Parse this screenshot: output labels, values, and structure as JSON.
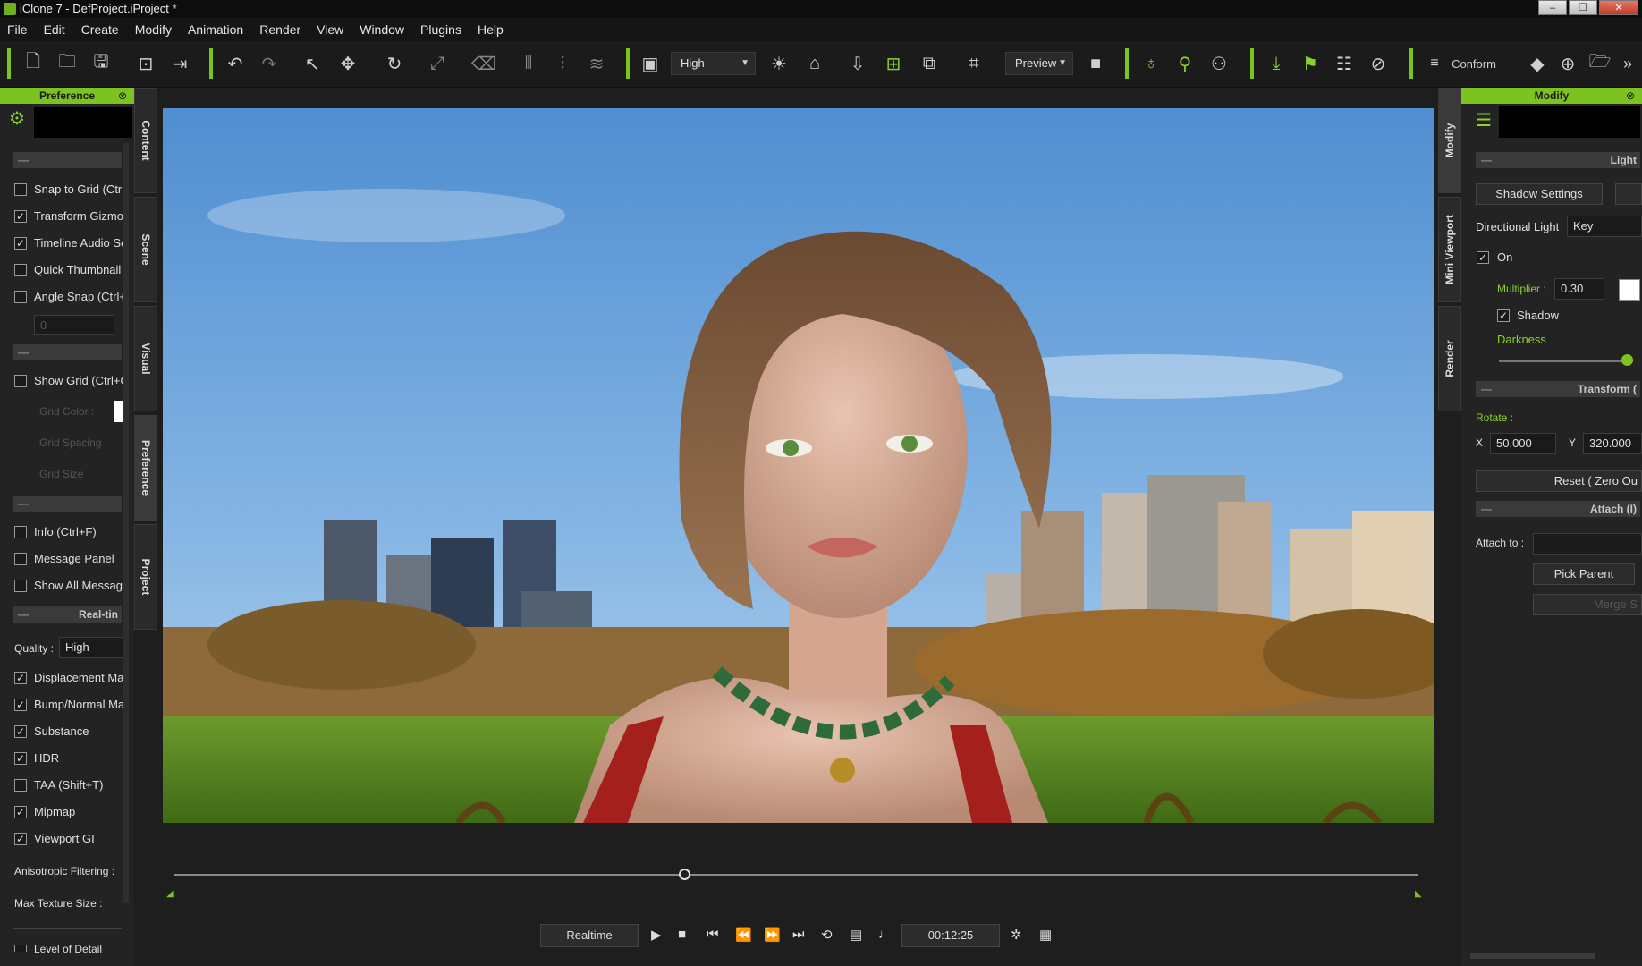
{
  "window": {
    "title": "iClone 7 - DefProject.iProject *",
    "buttons": [
      "–",
      "❐",
      "✕"
    ]
  },
  "menu": [
    "File",
    "Edit",
    "Create",
    "Modify",
    "Animation",
    "Render",
    "View",
    "Window",
    "Plugins",
    "Help"
  ],
  "toolbar": {
    "quality": "High",
    "view_mode": "Preview",
    "conform": "Conform",
    "more": "»"
  },
  "left": {
    "title": "Preference",
    "close": "⊗",
    "checks": [
      "Snap to Grid (Ctrl+",
      "Transform Gizmo",
      "Timeline Audio Sc",
      "Quick Thumbnail (",
      "Angle Snap (Ctrl+",
      "Show Grid (Ctrl+G",
      "Info (Ctrl+F)",
      "Message Panel",
      "Show All Message",
      "Displacement Ma",
      "Bump/Normal Ma",
      "Substance",
      "HDR",
      "TAA (Shift+T)",
      "Mipmap",
      "Viewport GI",
      "Level of Detail"
    ],
    "angle_value": "0",
    "grid_labels": [
      "Grid Color :",
      "Grid Spacing",
      "Grid Size"
    ],
    "realtime": "Real-tin",
    "quality_label": "Quality :",
    "quality_value": "High",
    "aniso": "Anisotropic Filtering :",
    "maxtex": "Max Texture Size :"
  },
  "tabs_left": [
    "Content",
    "Scene",
    "Visual",
    "Preference",
    "Project"
  ],
  "tabs_right": [
    "Modify",
    "Mini Viewport",
    "Render"
  ],
  "right": {
    "title": "Modify",
    "close": "⊗",
    "light": "Light",
    "shadow_settings": "Shadow Settings",
    "dir_light": "Directional Light",
    "dir_light_value": "Key",
    "on": "On",
    "multiplier": "Multiplier :",
    "multiplier_value": "0.30",
    "shadow": "Shadow",
    "darkness": "Darkness",
    "transform": "Transform (",
    "rotate": "Rotate :",
    "x": "X",
    "x_value": "50.000",
    "y": "Y",
    "y_value": "320.000",
    "reset": "Reset ( Zero Ou",
    "attach": "Attach (I)",
    "attach_to": "Attach to :",
    "pick_parent": "Pick Parent",
    "merge": "Merge S"
  },
  "playback": {
    "realtime": "Realtime",
    "time": "00:12:25",
    "progress": 0.41
  },
  "colors": {
    "accent": "#7cc220"
  }
}
